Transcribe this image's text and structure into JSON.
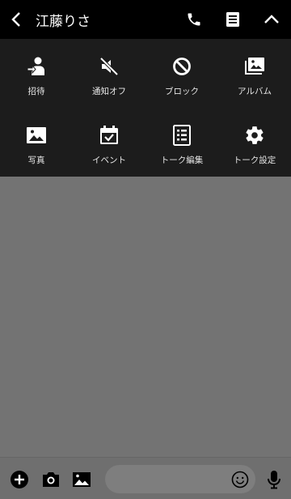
{
  "header": {
    "title": "江藤りさ",
    "back_icon": "chevron-left-icon",
    "call_icon": "phone-icon",
    "notes_icon": "notes-icon",
    "collapse_icon": "chevron-up-icon"
  },
  "menu": {
    "items": [
      {
        "label": "招待",
        "icon": "invite-icon"
      },
      {
        "label": "通知オフ",
        "icon": "mute-icon"
      },
      {
        "label": "ブロック",
        "icon": "block-icon"
      },
      {
        "label": "アルバム",
        "icon": "album-icon"
      },
      {
        "label": "写真",
        "icon": "photo-icon"
      },
      {
        "label": "イベント",
        "icon": "event-icon"
      },
      {
        "label": "トーク編集",
        "icon": "edit-talk-icon"
      },
      {
        "label": "トーク設定",
        "icon": "settings-icon"
      }
    ]
  },
  "composer": {
    "add_icon": "plus-icon",
    "camera_icon": "camera-icon",
    "image_icon": "image-icon",
    "input_value": "",
    "emoji_icon": "emoji-icon",
    "mic_icon": "microphone-icon"
  },
  "colors": {
    "header_bg": "#000000",
    "menu_bg": "#1c1c1c",
    "chat_bg": "#737373",
    "icon": "#ffffff"
  }
}
